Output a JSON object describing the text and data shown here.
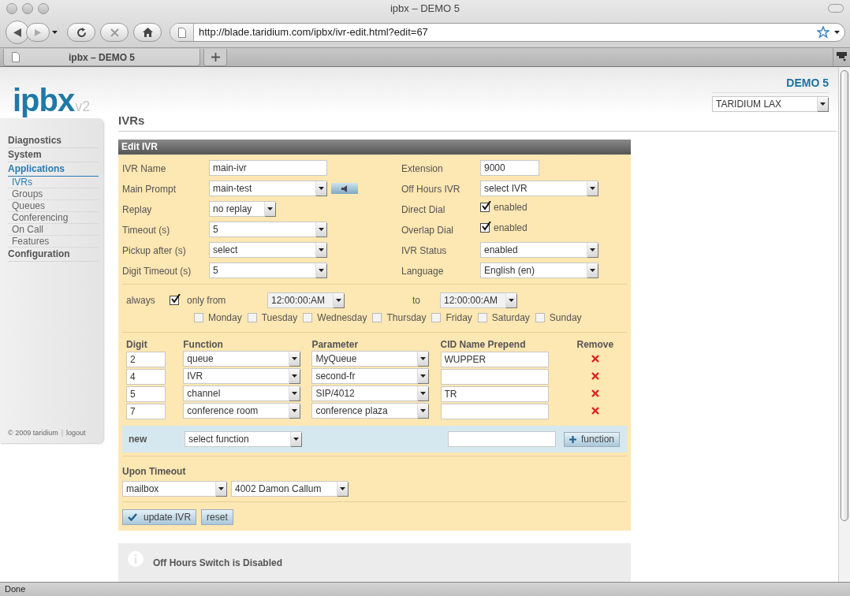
{
  "window": {
    "title": "ipbx – DEMO 5"
  },
  "toolbar": {
    "url": "http://blade.taridium.com/ipbx/ivr-edit.html?edit=67"
  },
  "tabs": [
    {
      "label": "ipbx – DEMO 5",
      "selected": true
    }
  ],
  "header": {
    "logo": "ipbx",
    "logo_version": "v2",
    "site": "DEMO 5",
    "location_select": "TARIDIUM LAX"
  },
  "sidebar": {
    "items": [
      {
        "label": "Diagnostics",
        "selected": false
      },
      {
        "label": "System",
        "selected": false
      },
      {
        "label": "Applications",
        "selected": true,
        "children": [
          {
            "label": "IVRs",
            "selected": true
          },
          {
            "label": "Groups",
            "selected": false
          },
          {
            "label": "Queues",
            "selected": false
          },
          {
            "label": "Conferencing",
            "selected": false
          },
          {
            "label": "On Call",
            "selected": false
          },
          {
            "label": "Features",
            "selected": false
          }
        ]
      },
      {
        "label": "Configuration",
        "selected": false
      }
    ],
    "copyright": "© 2009 taridium",
    "separator": "|",
    "logout": "logout"
  },
  "page_title": "IVRs",
  "form": {
    "title": "Edit IVR",
    "left_fields": [
      {
        "label": "IVR Name",
        "kind": "text",
        "value": "main-ivr"
      },
      {
        "label": "Main Prompt",
        "kind": "select",
        "value": "main-test",
        "play_button": true
      },
      {
        "label": "Replay",
        "kind": "select",
        "value": "no replay"
      },
      {
        "label": "Timeout (s)",
        "kind": "select",
        "value": "5"
      },
      {
        "label": "Pickup after (s)",
        "kind": "select",
        "value": "select"
      },
      {
        "label": "Digit Timeout (s)",
        "kind": "select",
        "value": "5"
      }
    ],
    "right_fields": [
      {
        "label": "Extension",
        "kind": "text",
        "value": "9000"
      },
      {
        "label": "Off Hours IVR",
        "kind": "select",
        "value": "select IVR"
      },
      {
        "label": "Direct Dial",
        "kind": "checkbox",
        "value": "enabled",
        "checked": true
      },
      {
        "label": "Overlap Dial",
        "kind": "checkbox",
        "value": "enabled",
        "checked": true
      },
      {
        "label": "IVR Status",
        "kind": "select",
        "value": "enabled"
      },
      {
        "label": "Language",
        "kind": "select",
        "value": "English (en)"
      }
    ],
    "schedule": {
      "always_label": "always",
      "always_checked": true,
      "from_label": "only from",
      "from": "12:00:00:AM",
      "to_label": "to",
      "to": "12:00:00:AM",
      "days": [
        {
          "label": "Monday",
          "checked": false
        },
        {
          "label": "Tuesday",
          "checked": false
        },
        {
          "label": "Wednesday",
          "checked": false
        },
        {
          "label": "Thursday",
          "checked": false
        },
        {
          "label": "Friday",
          "checked": false
        },
        {
          "label": "Saturday",
          "checked": false
        },
        {
          "label": "Sunday",
          "checked": false
        }
      ]
    },
    "digit_table": {
      "columns": [
        "Digit",
        "Function",
        "Parameter",
        "CID Name Prepend",
        "Remove"
      ],
      "rows": [
        {
          "digit": "2",
          "function": "queue",
          "parameter": "MyQueue",
          "cid": "WUPPER"
        },
        {
          "digit": "4",
          "function": "IVR",
          "parameter": "second-fr",
          "cid": ""
        },
        {
          "digit": "5",
          "function": "channel",
          "parameter": "SIP/4012",
          "cid": "TR"
        },
        {
          "digit": "7",
          "function": "conference room",
          "parameter": "conference plaza",
          "cid": ""
        }
      ],
      "new_row": {
        "label": "new",
        "function": "select function",
        "button": "function"
      }
    },
    "timeout": {
      "label": "Upon Timeout",
      "action": "mailbox",
      "target": "4002 Damon Callum"
    },
    "buttons": [
      {
        "label": "update IVR",
        "kind": "submit"
      },
      {
        "label": "reset",
        "kind": "reset"
      }
    ]
  },
  "info": {
    "title": "Off Hours Switch is Disabled"
  },
  "status_bar": "Done"
}
